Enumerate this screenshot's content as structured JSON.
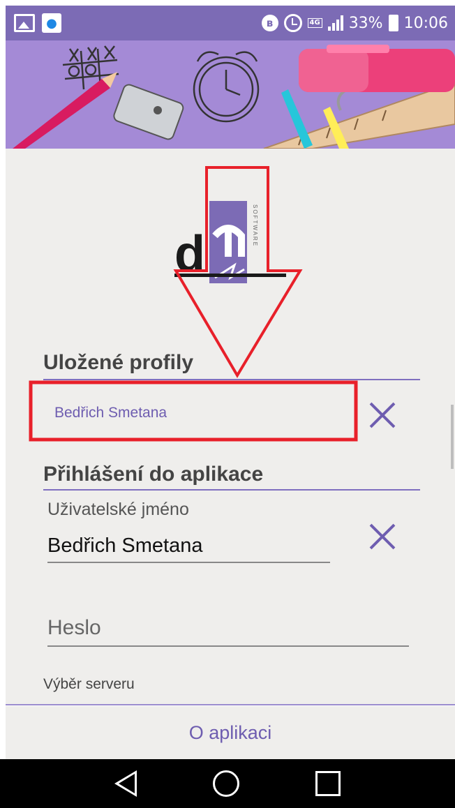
{
  "status_bar": {
    "battery_percent": "33%",
    "time": "10:06",
    "network": "4G",
    "icons": [
      "image-icon",
      "water-drop-icon",
      "bluetooth-icon",
      "alarm-icon",
      "signal-icon",
      "battery-icon"
    ]
  },
  "logo": {
    "letter": "d",
    "vertical_text": "SOFTWARE"
  },
  "saved_profiles": {
    "title": "Uložené profily",
    "items": [
      {
        "name": "Bedřich Smetana"
      }
    ]
  },
  "login": {
    "title": "Přihlášení do aplikace",
    "username_label": "Uživatelské jméno",
    "username_value": "Bedřich Smetana",
    "password_placeholder": "Heslo",
    "server_label": "Výběr serveru"
  },
  "footer": {
    "about_label": "O aplikaci"
  },
  "colors": {
    "accent": "#6e5db0",
    "status_bar": "#7c6bb5",
    "header": "#a48ad6",
    "content_bg": "#efeeec",
    "annotation": "#e8202a"
  }
}
